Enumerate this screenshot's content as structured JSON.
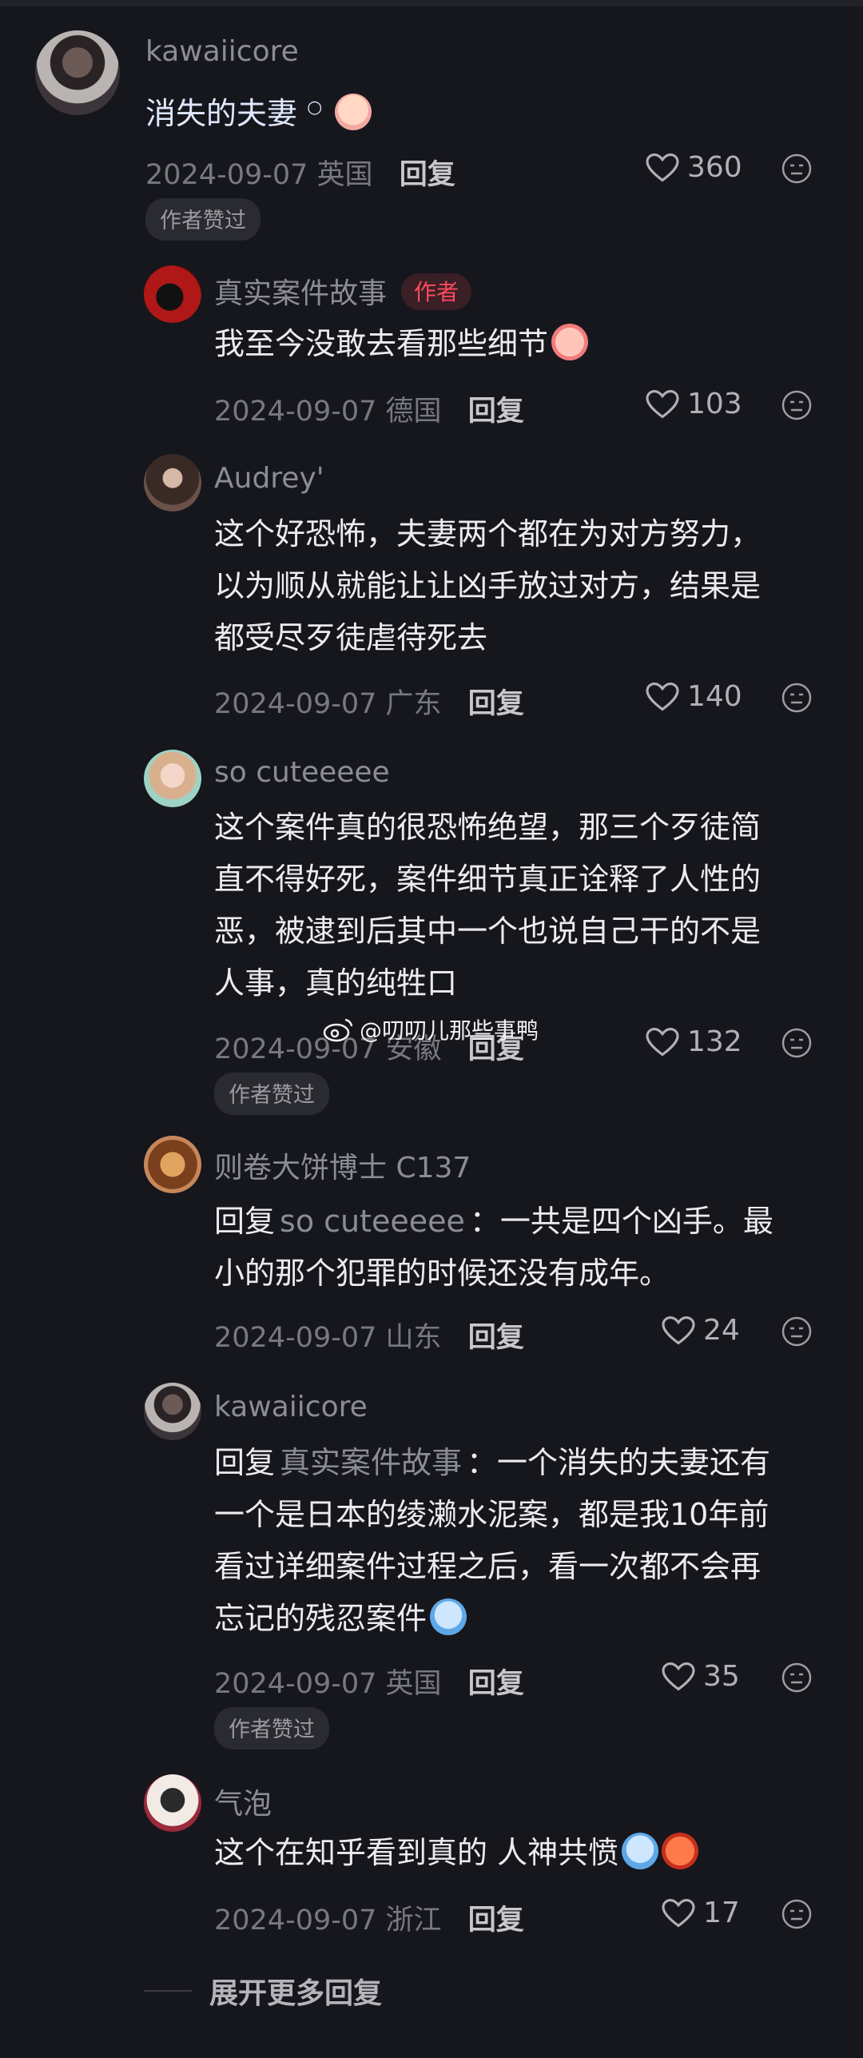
{
  "comments": [
    {
      "username": "kawaiicore",
      "text": "消失的夫妻",
      "date": "2024-09-07",
      "location": "英国",
      "reply_label": "回复",
      "likes": "360",
      "badge": "作者赞过"
    },
    {
      "username": "真实案件故事",
      "author_tag": "作者",
      "text": "我至今没敢去看那些细节",
      "date": "2024-09-07",
      "location": "德国",
      "reply_label": "回复",
      "likes": "103"
    },
    {
      "username": "Audrey'",
      "lines": [
        "这个好恐怖，夫妻两个都在为对方努力，",
        "以为顺从就能让让凶手放过对方，结果是",
        "都受尽歹徒虐待死去"
      ],
      "date": "2024-09-07",
      "location": "广东",
      "reply_label": "回复",
      "likes": "140"
    },
    {
      "username": "so cuteeeee",
      "lines": [
        "这个案件真的很恐怖绝望，那三个歹徒简",
        "直不得好死，案件细节真正诠释了人性的",
        "恶，被逮到后其中一个也说自己干的不是",
        "人事，真的纯牲口"
      ],
      "date": "2024-09-07",
      "location": "安徽",
      "reply_label": "回复",
      "likes": "132",
      "badge": "作者赞过"
    },
    {
      "username": "则卷大饼博士 C137",
      "reply_prefix": "回复",
      "mention": "so cuteeeee",
      "lines": [
        "：一共是四个凶手。最",
        "小的那个犯罪的时候还没有成年。"
      ],
      "date": "2024-09-07",
      "location": "山东",
      "reply_label": "回复",
      "likes": "24"
    },
    {
      "username": "kawaiicore",
      "reply_prefix": "回复",
      "mention": "真实案件故事",
      "lines": [
        "：一个消失的夫妻还有",
        "一个是日本的绫濑水泥案，都是我10年前",
        "看过详细案件过程之后，看一次都不会再",
        "忘记的残忍案件"
      ],
      "date": "2024-09-07",
      "location": "英国",
      "reply_label": "回复",
      "likes": "35",
      "badge": "作者赞过"
    },
    {
      "username": "气泡",
      "text": "这个在知乎看到真的 人神共愤",
      "date": "2024-09-07",
      "location": "浙江",
      "reply_label": "回复",
      "likes": "17"
    }
  ],
  "watermark": "@叨叨儿那些事鸭",
  "more_replies": "展开更多回复",
  "colors": {
    "background": "#16161d",
    "author_tag": "#fe4a5f",
    "muted": "#8c8c94"
  }
}
